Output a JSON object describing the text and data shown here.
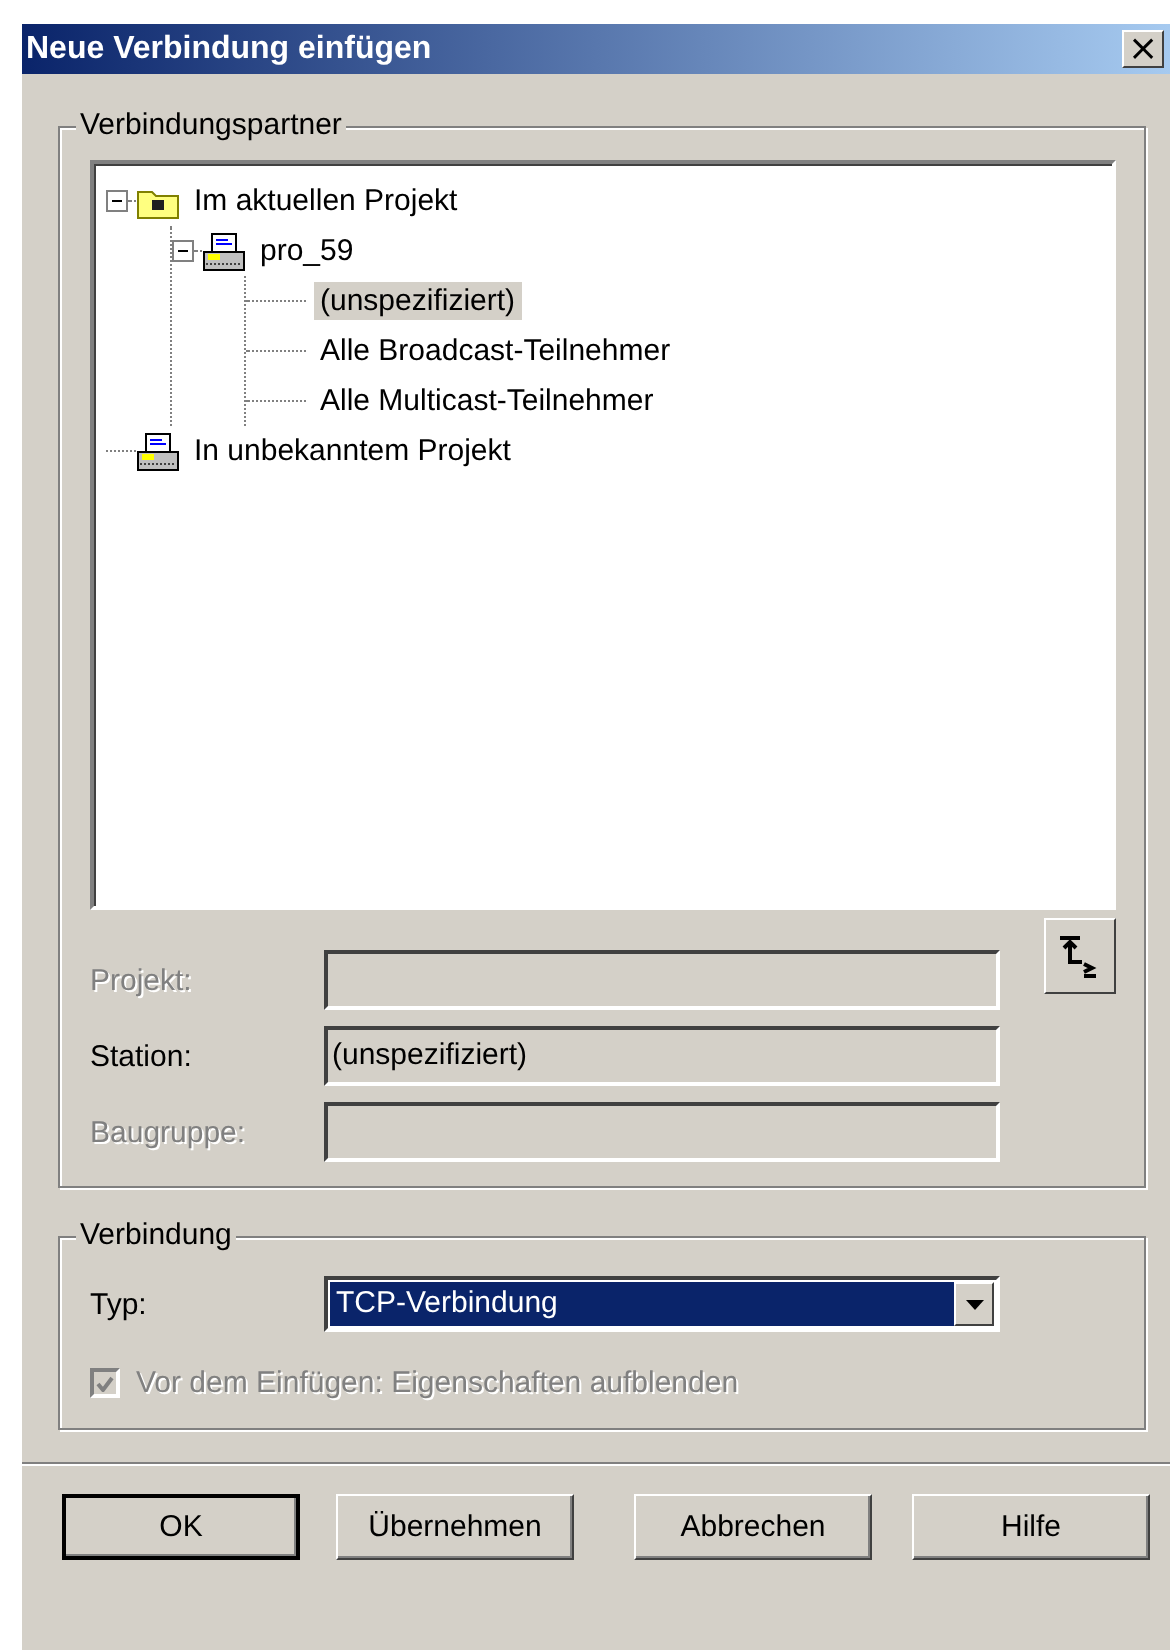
{
  "window": {
    "title": "Neue Verbindung einfügen",
    "close": "×"
  },
  "partner_group": {
    "title": "Verbindungspartner",
    "tree": [
      {
        "label": "Im aktuellen Projekt",
        "kind": "folder",
        "expanded": true,
        "selected": false,
        "children": [
          {
            "label": "pro_59",
            "kind": "station",
            "expanded": true,
            "selected": false,
            "children": [
              {
                "label": "(unspezifiziert)",
                "kind": "leaf",
                "selected": true
              },
              {
                "label": "Alle Broadcast-Teilnehmer",
                "kind": "leaf",
                "selected": false
              },
              {
                "label": "Alle Multicast-Teilnehmer",
                "kind": "leaf",
                "selected": false
              }
            ]
          }
        ]
      },
      {
        "label": "In unbekanntem Projekt",
        "kind": "station",
        "selected": false
      }
    ],
    "fields": [
      {
        "label": "Projekt:",
        "disabled": true
      },
      {
        "label": "Station:",
        "disabled": false,
        "value": "(unspezifiziert)"
      },
      {
        "label": "Baugruppe:",
        "disabled": true
      }
    ]
  },
  "connection_group": {
    "title": "Verbindung",
    "type_label": "Typ:",
    "type_value": "TCP-Verbindung",
    "checkbox": {
      "label": "Vor dem Einfügen: Eigenschaften aufblenden",
      "checked": true,
      "disabled": true
    }
  },
  "buttons": [
    {
      "label": "OK",
      "default": true
    },
    {
      "label": "Übernehmen",
      "default": false
    },
    {
      "label": "Abbrechen",
      "default": false
    },
    {
      "label": "Hilfe",
      "default": false
    }
  ]
}
